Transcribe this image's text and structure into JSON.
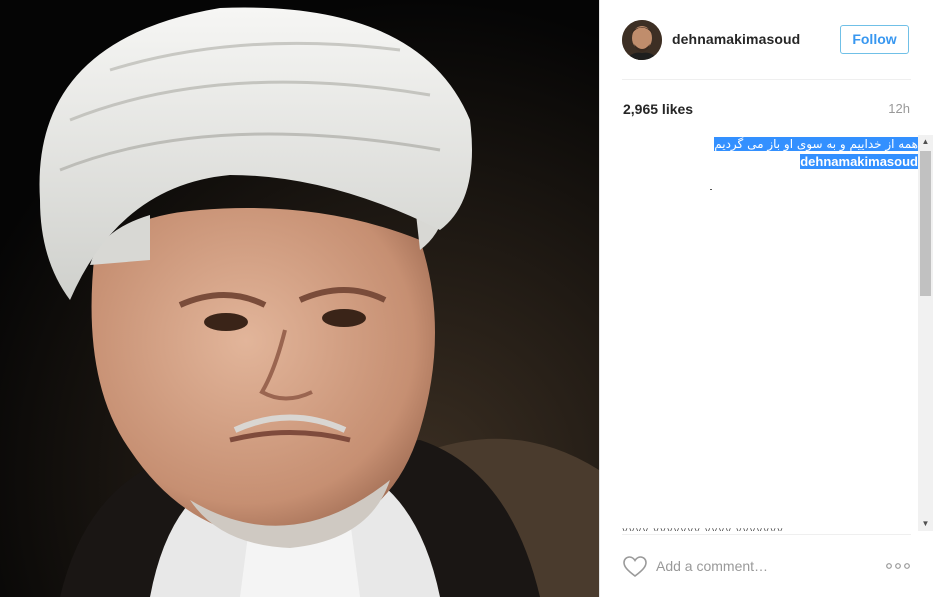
{
  "post": {
    "username": "dehnamakimasoud",
    "follow_label": "Follow",
    "likes": "2,965 likes",
    "time_ago": "12h",
    "caption_user": "dehnamakimasoud",
    "caption_text": "همه از خداییم و به سوی او باز می گردیم"
  },
  "comment_box": {
    "placeholder": "Add a comment…"
  },
  "icons": {
    "heart": "heart-outline-icon",
    "more": "more-options-icon",
    "scroll_up": "scroll-up-arrow-icon",
    "scroll_down": "scroll-down-arrow-icon"
  },
  "colors": {
    "follow_accent": "#3897f0",
    "selection": "#3390ff",
    "photo_background": "#0b0b0b"
  }
}
